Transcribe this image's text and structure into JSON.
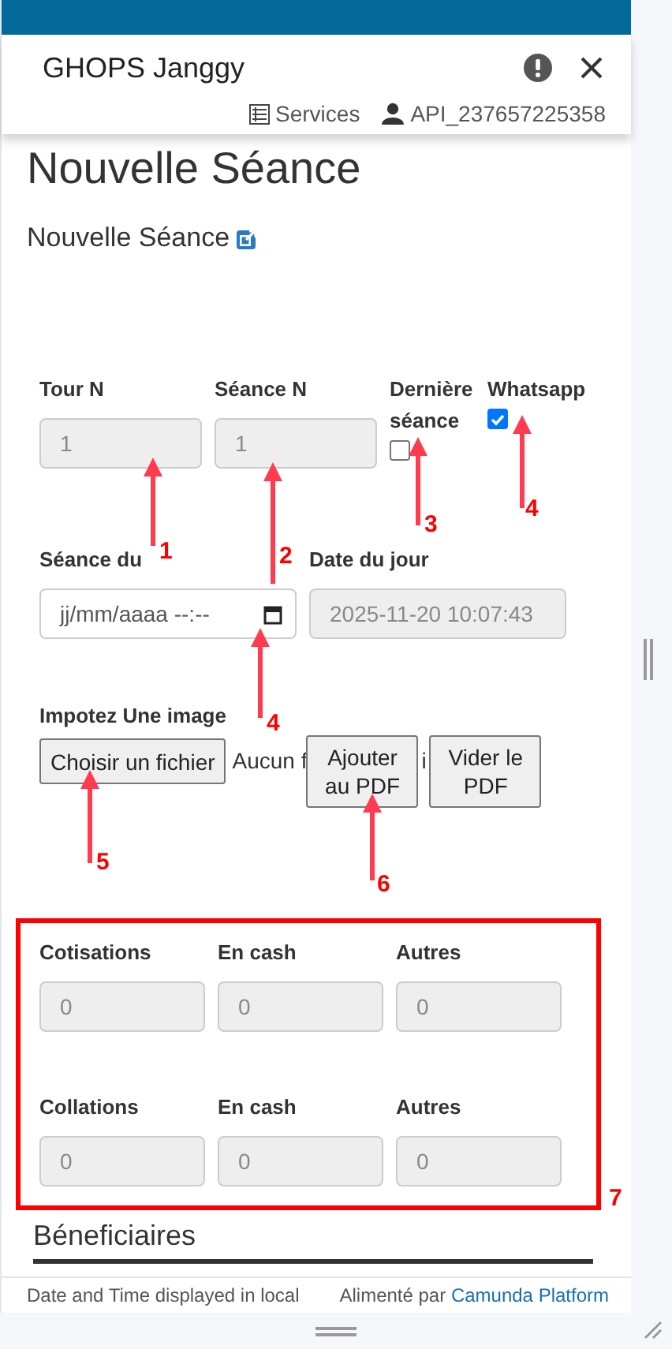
{
  "header": {
    "title": "GHOPS Janggy",
    "services": "Services",
    "user": "API_237657225358"
  },
  "page_title": "Nouvelle Séance",
  "form_title": "Nouvelle Séance",
  "row1": [
    {
      "label": "Tour N",
      "kind": "text",
      "value": "1",
      "disabled": true
    },
    {
      "label": "Séance N",
      "kind": "text",
      "value": "1",
      "disabled": true
    },
    {
      "label": "Dernière séance",
      "kind": "checkbox",
      "checked": false
    },
    {
      "label": "Whatsapp",
      "kind": "checkbox",
      "checked": true
    }
  ],
  "row2": [
    {
      "label": "Séance du",
      "kind": "datetime",
      "placeholder": "jj/mm/aaaa --:--",
      "disabled": false
    },
    {
      "label": "Date du jour",
      "kind": "text",
      "value": "2025-11-20 10:07:43",
      "disabled": true
    }
  ],
  "upload": {
    "label": "Impotez Une image",
    "choose_button": "Choisir un fichier",
    "status": "Aucun f",
    "status_tail": "i",
    "buttons": [
      "Ajouter au PDF",
      "Vider le PDF"
    ]
  },
  "totals": [
    {
      "fields": [
        {
          "label": "Cotisations",
          "value": "0",
          "disabled": true
        },
        {
          "label": "En cash",
          "value": "0",
          "disabled": true
        },
        {
          "label": "Autres",
          "value": "0",
          "disabled": true
        }
      ]
    },
    {
      "fields": [
        {
          "label": "Collations",
          "value": "0",
          "disabled": true
        },
        {
          "label": "En cash",
          "value": "0",
          "disabled": true
        },
        {
          "label": "Autres",
          "value": "0",
          "disabled": true
        }
      ]
    }
  ],
  "beneficiaries_heading": "Béneficiaires",
  "footer": {
    "note": "Date and Time displayed in local",
    "powered_by": "Alimenté par",
    "link": "Camunda Platform"
  },
  "annotations": [
    {
      "label": "1"
    },
    {
      "label": "2"
    },
    {
      "label": "3"
    },
    {
      "label": "4"
    },
    {
      "label": "4"
    },
    {
      "label": "5"
    },
    {
      "label": "6"
    },
    {
      "label": "7"
    }
  ]
}
